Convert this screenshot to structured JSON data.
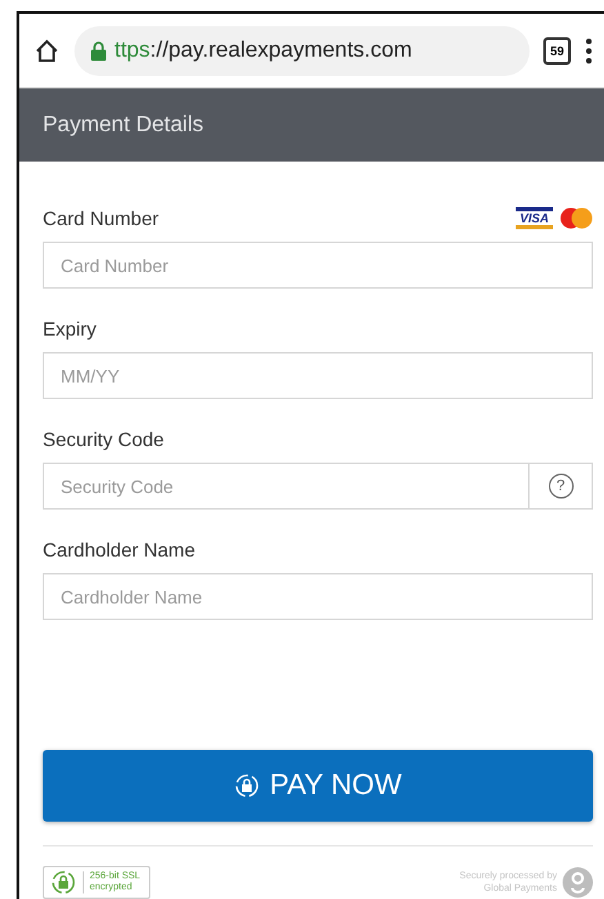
{
  "browser": {
    "url_scheme": "ttps",
    "url_rest": "://pay.realexpayments.com",
    "tab_count": "59"
  },
  "header": {
    "title": "Payment Details"
  },
  "card_brands": [
    {
      "kind": "visa",
      "label": "VISA"
    },
    {
      "kind": "mastercard"
    }
  ],
  "fields": [
    {
      "label": "Card Number",
      "placeholder": "Card Number",
      "help": false
    },
    {
      "label": "Expiry",
      "placeholder": "MM/YY",
      "help": false
    },
    {
      "label": "Security Code",
      "placeholder": "Security Code",
      "help": true,
      "help_symbol": "?"
    },
    {
      "label": "Cardholder Name",
      "placeholder": "Cardholder Name",
      "help": false
    }
  ],
  "pay_button": {
    "label": "PAY NOW"
  },
  "ssl_badge": {
    "text": "256-bit SSL encrypted"
  },
  "processed_by": {
    "line1": "Securely processed by",
    "line2": "Global Payments"
  }
}
